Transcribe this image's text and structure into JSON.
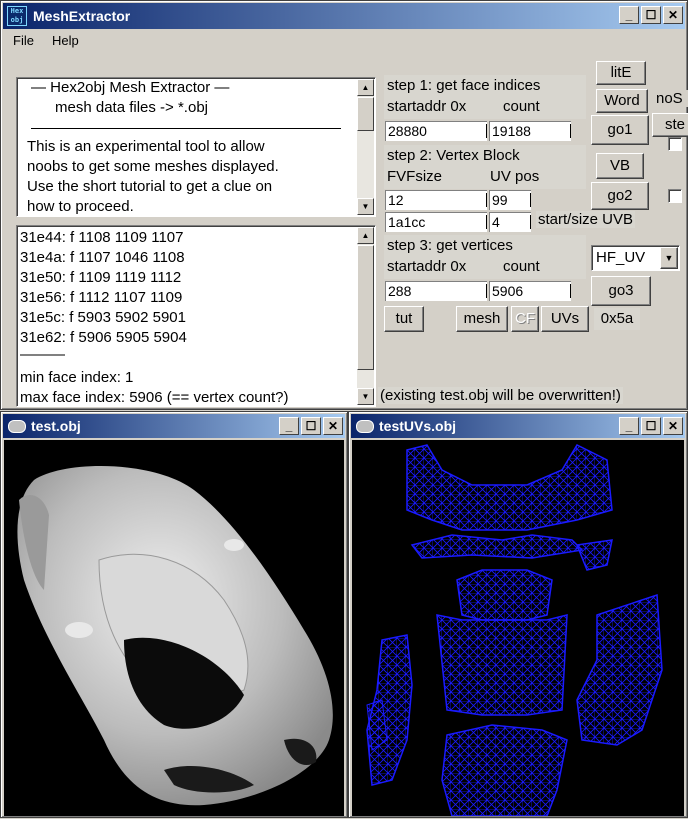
{
  "main_window": {
    "title": "MeshExtractor",
    "icon_text_1": "Hex",
    "icon_text_2": "obj",
    "menu": [
      "File",
      "Help"
    ]
  },
  "info_text": {
    "lines": [
      "—   Hex2obj Mesh Extractor   —",
      "mesh data files -> *.obj",
      "This is an experimental tool to allow",
      "noobs to get some meshes displayed.",
      "Use the short tutorial to get a clue on",
      "how to proceed."
    ]
  },
  "log_text": {
    "lines": [
      "31e44: f  1108 1109 1107",
      "31e4a: f  1107 1046 1108",
      "31e50: f  1109 1119 1112",
      "31e56: f  1112 1107 1109",
      "31e5c: f  5903 5902 5901",
      "31e62: f  5906 5905 5904",
      "———",
      "min face index: 1",
      "max face index: 5906 (== vertex count?)"
    ]
  },
  "step1": {
    "title": "step 1: get face indices",
    "startaddr_label": "startaddr 0x",
    "count_label": "count",
    "startaddr": "28880",
    "count": "19188",
    "go_label": "go1"
  },
  "step2": {
    "title": "step 2: Vertex Block",
    "fvf_label": "FVFsize",
    "uvpos_label": "UV pos",
    "fvfsize": "12",
    "uvpos": "99",
    "uvb_start": "1a1cc",
    "uvb_size": "4",
    "uvb_label": "start/size UVB",
    "go_label": "go2",
    "vb_label": "VB"
  },
  "step3": {
    "title": "step 3: get vertices",
    "startaddr_label": "startaddr 0x",
    "count_label": "count",
    "startaddr": "288",
    "count": "5906",
    "go_label": "go3",
    "format_select": "HF_UV"
  },
  "side_buttons": {
    "lite": "litE",
    "word": "Word",
    "nos_label": "noS",
    "ste_label": "ste"
  },
  "bottom_buttons": {
    "tut": "tut",
    "mesh": "mesh",
    "cf": "CF",
    "uvs": "UVs",
    "hex_value": "0x5a"
  },
  "overwrite_note": "(existing test.obj will be overwritten!)",
  "mesh_window": {
    "title": "test.obj"
  },
  "uv_window": {
    "title": "testUVs.obj"
  },
  "colors": {
    "title_active": "#0a246a",
    "uv_wire": "#1a1aff",
    "viewport_bg": "#000000"
  }
}
